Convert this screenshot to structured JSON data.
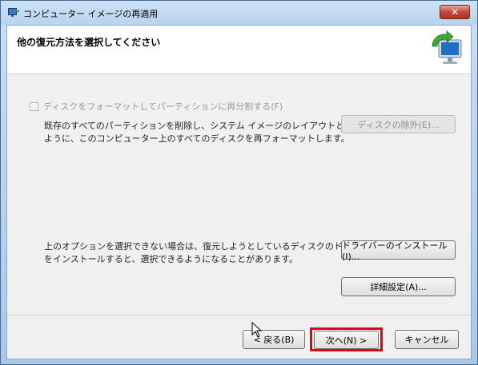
{
  "window": {
    "title": "コンピューター イメージの再適用",
    "close_label": "✕"
  },
  "header": {
    "title": "他の復元方法を選択してください"
  },
  "format_option": {
    "checkbox_label": "ディスクをフォーマットしてパーティションに再分割する(F)",
    "checked": false,
    "description_line1": "既存のすべてのパーティションを削除し、システム イメージのレイアウトと一致する",
    "description_line2": "ように、このコンピューター上のすべてのディスクを再フォーマットします。",
    "exclude_disks_label": "ディスクの除外(E)..."
  },
  "driver_option": {
    "description_line1": "上のオプションを選択できない場合は、復元しようとしているディスクのドライバー",
    "description_line2": "をインストールすると、選択できるようになることがあります。",
    "install_drivers_label": "ドライバーのインストール(I)...",
    "advanced_label": "詳細設定(A)..."
  },
  "footer": {
    "back_label": "< 戻る(B)",
    "next_label": "次へ(N) >",
    "cancel_label": "キャンセル"
  },
  "colors": {
    "highlight": "#e60012",
    "close_button": "#c4473a"
  }
}
